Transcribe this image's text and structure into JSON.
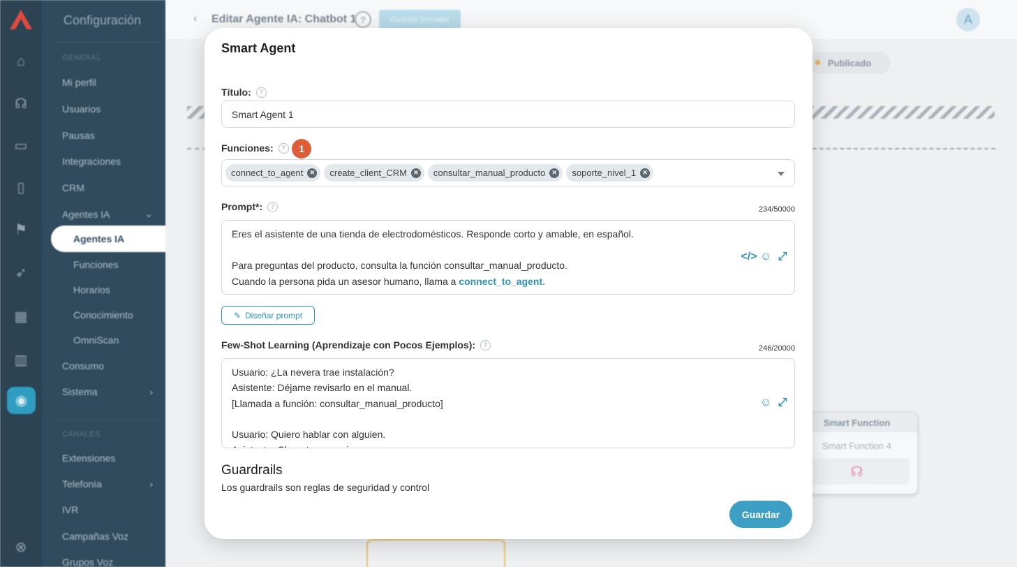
{
  "sidebar": {
    "title": "Configuración",
    "section_general": "GENERAL",
    "items": [
      "Mi perfil",
      "Usuarios",
      "Pausas",
      "Integraciones",
      "CRM",
      "Agentes IA"
    ],
    "sub_items": [
      "Agentes IA",
      "Funciones",
      "Horarios",
      "Conocimiento",
      "OmniScan"
    ],
    "items_after": [
      "Consumo",
      "Sistema"
    ],
    "section_channels": "CANALES",
    "items_channels": [
      "Extensiones",
      "Telefonía",
      "IVR",
      "Campañas Voz",
      "Grupos Voz"
    ]
  },
  "topbar": {
    "title": "Editar Agente IA: Chatbot 1",
    "help": "?",
    "draft_button": "Guardar borrador",
    "avatar": "A"
  },
  "canvas": {
    "publish_toggle": "Publicado",
    "smart_function_card": {
      "header": "Smart Function",
      "name": "Smart Function 4"
    }
  },
  "modal": {
    "title": "Smart Agent",
    "titulo_label": "Título:",
    "titulo_value": "Smart Agent 1",
    "funciones_label": "Funciones:",
    "funciones_badge": "1",
    "functions": [
      "connect_to_agent",
      "create_client_CRM",
      "consultar_manual_producto",
      "soporte_nivel_1"
    ],
    "prompt_label": "Prompt*:",
    "prompt_counter": "234/50000",
    "prompt_lines": [
      "Eres el asistente de una tienda de electrodomésticos. Responde corto y amable, en español.",
      "",
      "Para preguntas del producto, consulta la función consultar_manual_producto.",
      "Cuando la persona pida un asesor humano, llama a "
    ],
    "prompt_link": "connect_to_agent",
    "prompt_link_suffix": ".",
    "design_button": "Diseñar prompt",
    "fewshot_label": "Few-Shot Learning (Aprendizaje con Pocos Ejemplos):",
    "fewshot_counter": "246/20000",
    "fewshot_lines": [
      "Usuario: ¿La nevera trae instalación?",
      "Asistente: Déjame revisarlo en el manual.",
      "[Llamada a función: consultar_manual_producto]",
      "",
      "Usuario: Quiero hablar con alguien.",
      "Asistente: Claro, te comunico con un asesor."
    ],
    "guardrails_title": "Guardrails",
    "guardrails_desc": "Los guardrails son reglas de seguridad y control",
    "save_button": "Guardar"
  }
}
